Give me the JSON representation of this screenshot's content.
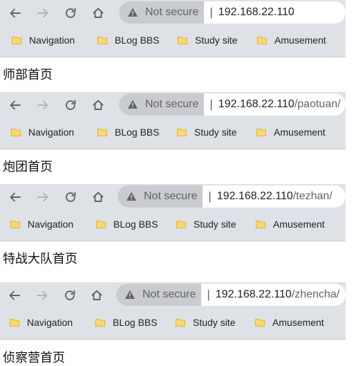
{
  "common": {
    "not_secure": "Not secure",
    "separator": "|",
    "bookmarks": [
      "Navigation",
      "BLog BBS",
      "Study site",
      "Amusement"
    ]
  },
  "screens": [
    {
      "host": "192.168.22.110",
      "path": "",
      "page_title": "师部首页"
    },
    {
      "host": "192.168.22.110",
      "path": "/paotuan/",
      "page_title": "炮团首页"
    },
    {
      "host": "192.168.22.110",
      "path": "/tezhan/",
      "page_title": "特战大队首页"
    },
    {
      "host": "192.168.22.110",
      "path": "/zhencha/",
      "page_title": "侦察营首页"
    }
  ],
  "icons": {
    "back": "arrow-left-icon",
    "forward": "arrow-right-icon",
    "reload": "reload-icon",
    "home": "home-icon",
    "warning": "warning-triangle-icon",
    "folder": "folder-icon"
  },
  "colors": {
    "toolbar_bg": "#dee1e6",
    "chip_bg": "#c9cbd0",
    "folder_fill": "#fcd96b",
    "folder_stroke": "#e0b23c",
    "icon": "#5f6368",
    "icon_disabled": "#b0b3b8"
  }
}
